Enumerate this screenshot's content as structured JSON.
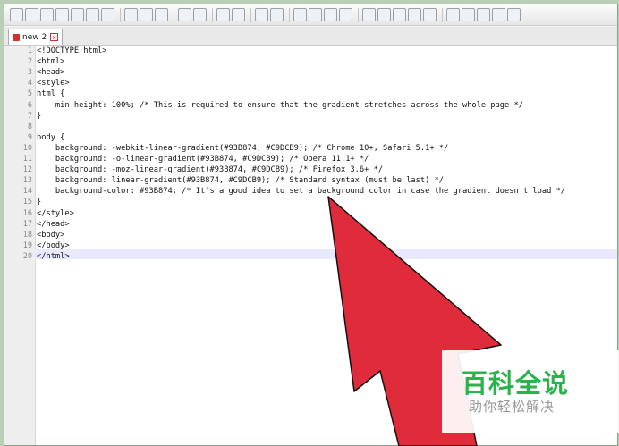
{
  "toolbar": {
    "icons": [
      "new-file",
      "open-file",
      "save",
      "save-all",
      "close",
      "close-all",
      "print",
      "cut",
      "copy",
      "paste",
      "undo",
      "redo",
      "find",
      "replace",
      "zoom-in",
      "zoom-out",
      "sync-v",
      "sync-h",
      "word-wrap",
      "show-all",
      "indent-guide",
      "user-lang",
      "doc-map",
      "function-list",
      "folder-workspace",
      "record-macro",
      "stop-macro",
      "play-macro",
      "run-macro",
      "save-macro"
    ]
  },
  "tab": {
    "label": "new 2"
  },
  "editor": {
    "lines": [
      "<!DOCTYPE html>",
      "<html>",
      "<head>",
      "<style>",
      "html {",
      "    min-height: 100%; /* This is required to ensure that the gradient stretches across the whole page */",
      "}",
      "",
      "body {",
      "    background: -webkit-linear-gradient(#93B874, #C9DCB9); /* Chrome 10+, Safari 5.1+ */",
      "    background: -o-linear-gradient(#93B874, #C9DCB9); /* Opera 11.1+ */",
      "    background: -moz-linear-gradient(#93B874, #C9DCB9); /* Firefox 3.6+ */",
      "    background: linear-gradient(#93B874, #C9DCB9); /* Standard syntax (must be last) */",
      "    background-color: #93B874; /* It's a good idea to set a background color in case the gradient doesn't load */",
      "}",
      "</style>",
      "</head>",
      "<body>",
      "</body>",
      "</html>"
    ],
    "line_numbers": [
      "1",
      "2",
      "3",
      "4",
      "5",
      "6",
      "7",
      "8",
      "9",
      "10",
      "11",
      "12",
      "13",
      "14",
      "15",
      "16",
      "17",
      "18",
      "19",
      "20"
    ]
  },
  "watermark": {
    "title": "百科全说",
    "subtitle": "助你轻松解决"
  },
  "colors": {
    "arrow": "#e02b3a",
    "watermark_green": "#2bb24c"
  }
}
